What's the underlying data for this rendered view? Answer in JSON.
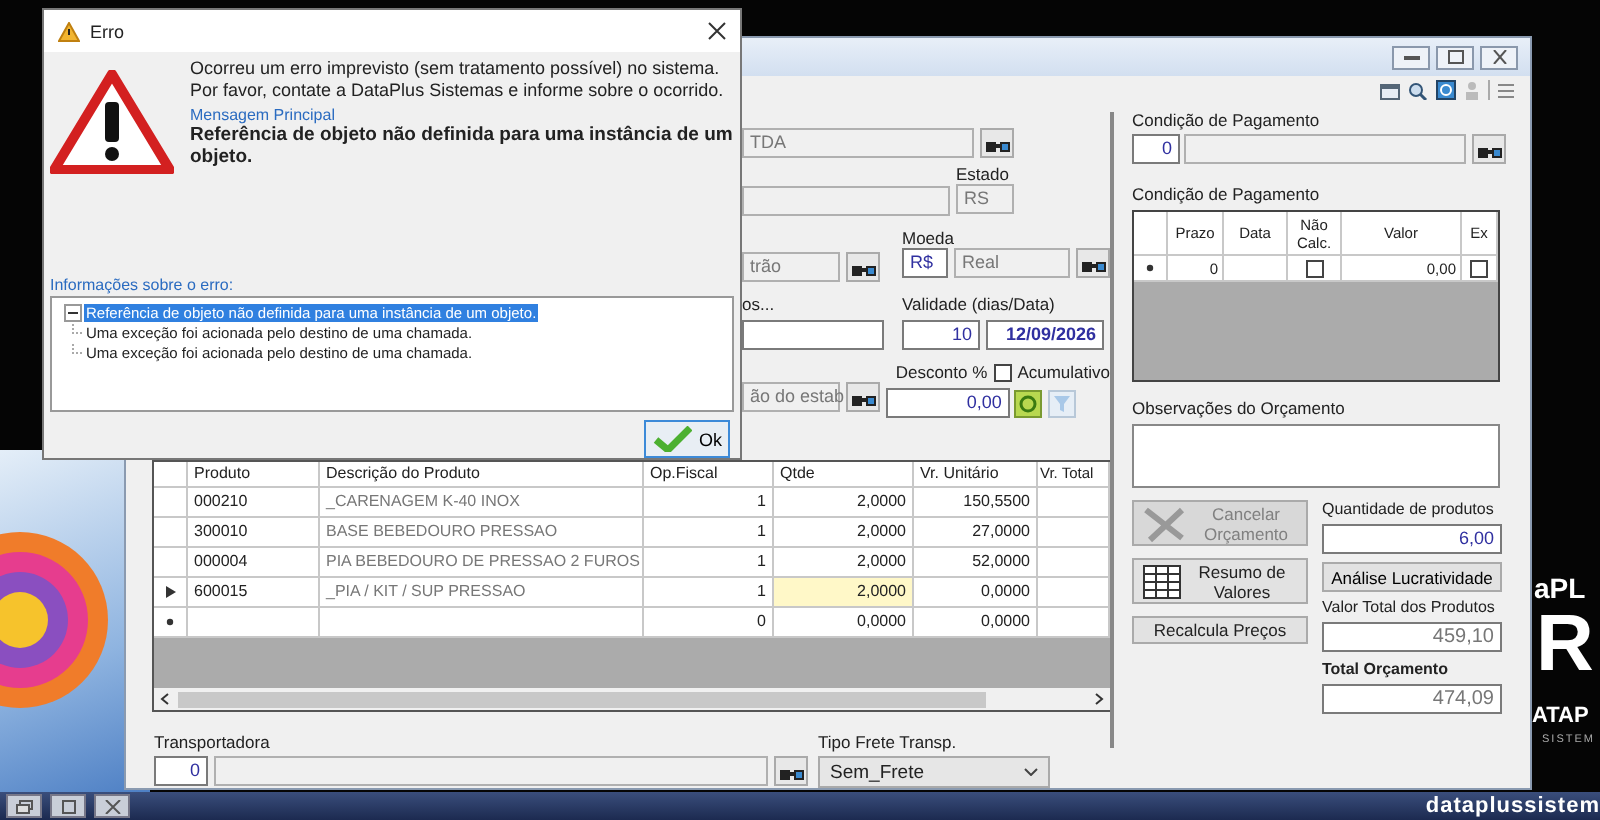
{
  "error_dialog": {
    "title": "Erro",
    "message_lines": [
      "Ocorreu um erro imprevisto (sem tratamento possível) no sistema.",
      "Por favor, contate a DataPlus Sistemas e informe sobre o ocorrido."
    ],
    "main_message_label": "Mensagem Principal",
    "main_message": "Referência de objeto não definida para uma instância de um objeto.",
    "details_label": "Informações sobre o erro:",
    "details_tree": [
      {
        "text": "Referência de objeto não definida para uma instância de um objeto.",
        "selected": true,
        "expanded": true,
        "children": [
          {
            "text": "Uma exceção foi acionada pelo destino de uma chamada.",
            "selected": false
          },
          {
            "text": "Uma exceção foi acionada pelo destino de uma chamada.",
            "selected": false
          }
        ]
      }
    ],
    "ok_button": "Ok"
  },
  "quote_form": {
    "customer_name": "TDA",
    "state_label": "Estado",
    "state": "RS",
    "price_table": "trão",
    "currency_label": "Moeda",
    "currency_code": "R$",
    "currency_name": "Real",
    "field_label_fragment": "os...",
    "validity_label": "Validade (dias/Data)",
    "validity_days": "10",
    "validity_date": "12/09/2026",
    "establishment": "ão do estab",
    "discount_label": "Desconto %",
    "cumulative_label": "Acumulativo",
    "cumulative_checked": false,
    "discount": "0,00"
  },
  "items_table": {
    "columns": [
      "Produto",
      "Descrição do Produto",
      "Op.Fiscal",
      "Qtde",
      "Vr. Unitário",
      "Vr. Total"
    ],
    "rows": [
      {
        "kind": "data",
        "product": "000210",
        "description": "_CARENAGEM K-40 INOX",
        "op_fiscal": "1",
        "qty": "2,0000",
        "unit_price": "150,5500",
        "focused": false
      },
      {
        "kind": "data",
        "product": "300010",
        "description": "BASE BEBEDOURO PRESSAO",
        "op_fiscal": "1",
        "qty": "2,0000",
        "unit_price": "27,0000",
        "focused": false
      },
      {
        "kind": "data",
        "product": "000004",
        "description": "PIA BEBEDOURO DE PRESSAO 2 FUROS",
        "op_fiscal": "1",
        "qty": "2,0000",
        "unit_price": "52,0000",
        "focused": false
      },
      {
        "kind": "current",
        "product": "600015",
        "description": "_PIA / KIT / SUP PRESSAO",
        "op_fiscal": "1",
        "qty": "2,0000",
        "unit_price": "0,0000",
        "focused": true
      },
      {
        "kind": "new",
        "op_fiscal": "0",
        "qty": "0,0000",
        "unit_price": "0,0000",
        "focused": false
      }
    ]
  },
  "transport": {
    "label": "Transportadora",
    "code": "0"
  },
  "freight": {
    "label": "Tipo Frete Transp.",
    "value": "Sem_Frete"
  },
  "payment_condition": {
    "label": "Condição de Pagamento",
    "code": "0"
  },
  "installments": {
    "label": "Condição de Pagamento",
    "columns": [
      "Prazo",
      "Data",
      "Não Calc.",
      "Valor",
      "Ex"
    ],
    "rows": [
      {
        "kind": "new",
        "term": "0",
        "not_calculated": false,
        "value": "0,00",
        "ex": false
      }
    ]
  },
  "notes": {
    "label": "Observações do Orçamento"
  },
  "actions": [
    {
      "kind": "cancel",
      "label": "Cancelar Orçamento",
      "disabled": true
    },
    {
      "kind": "summary",
      "label": "Resumo de Valores",
      "disabled": false
    },
    {
      "kind": "recalc",
      "label": "Recalcula Preços",
      "disabled": false
    }
  ],
  "totals": {
    "quantity_label": "Quantidade de produtos",
    "quantity": "6,00",
    "profit_button": "Análise Lucratividade",
    "products_total_label": "Valor Total dos Produtos",
    "products_total": "459,10",
    "total_label": "Total Orçamento",
    "total": "474,09"
  },
  "wallpaper": {
    "brand_fragment": "aPL",
    "brand_letter": "R",
    "brand_word": "ATAP",
    "brand_subtitle": "SISTEM",
    "site": "dataplussistem"
  }
}
